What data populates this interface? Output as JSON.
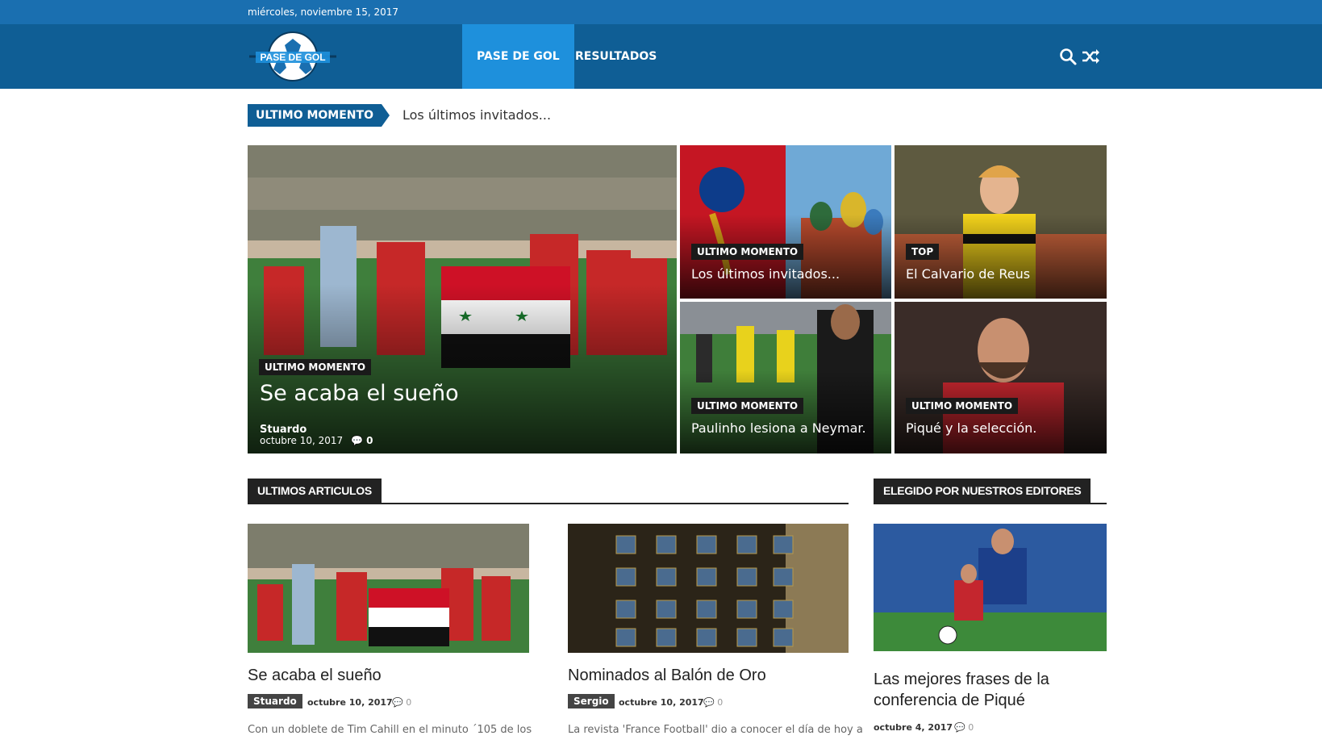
{
  "topbar": {
    "date": "miércoles, noviembre 15, 2017"
  },
  "logo": {
    "text": "PASE DE GOL"
  },
  "nav": {
    "items": [
      {
        "label": "PASE DE GOL"
      },
      {
        "label": "RESULTADOS"
      }
    ]
  },
  "icons": {
    "search": "search-icon",
    "random": "shuffle-icon"
  },
  "ticker": {
    "label": "ULTIMO MOMENTO",
    "text": "Los últimos invitados..."
  },
  "featured": {
    "main": {
      "category": "ULTIMO MOMENTO",
      "title": "Se acaba el sueño",
      "author": "Stuardo",
      "date": "octubre 10, 2017",
      "comments": "0"
    },
    "tiles": [
      {
        "category": "ULTIMO MOMENTO",
        "title": "Los últimos invitados..."
      },
      {
        "category": "TOP",
        "title": "El Calvario de Reus"
      },
      {
        "category": "ULTIMO MOMENTO",
        "title": "Paulinho lesiona a Neymar."
      },
      {
        "category": "ULTIMO MOMENTO",
        "title": "Piqué y la selección."
      }
    ]
  },
  "sections": {
    "latest": "ULTIMOS ARTICULOS",
    "editors": "ELEGIDO POR NUESTROS EDITORES"
  },
  "articles": [
    {
      "title": "Se acaba el sueño",
      "author": "Stuardo",
      "date": "octubre 10, 2017",
      "comments": "0",
      "excerpt": "Con un doblete de Tim Cahill en el minuto ´105 de los"
    },
    {
      "title": "Nominados al Balón de Oro",
      "author": "Sergio",
      "date": "octubre 10, 2017",
      "comments": "0",
      "excerpt": "La revista 'France Football' dio a conocer el día de hoy a"
    }
  ],
  "editors_pick": {
    "title_line1": "Las mejores frases de la",
    "title_line2": "conferencia de Piqué",
    "date": "octubre 4, 2017",
    "comments": "0"
  },
  "colors": {
    "topbar": "#1a6fb0",
    "nav": "#0f5e95",
    "nav_active": "#1e90dc",
    "dark": "#222222"
  }
}
